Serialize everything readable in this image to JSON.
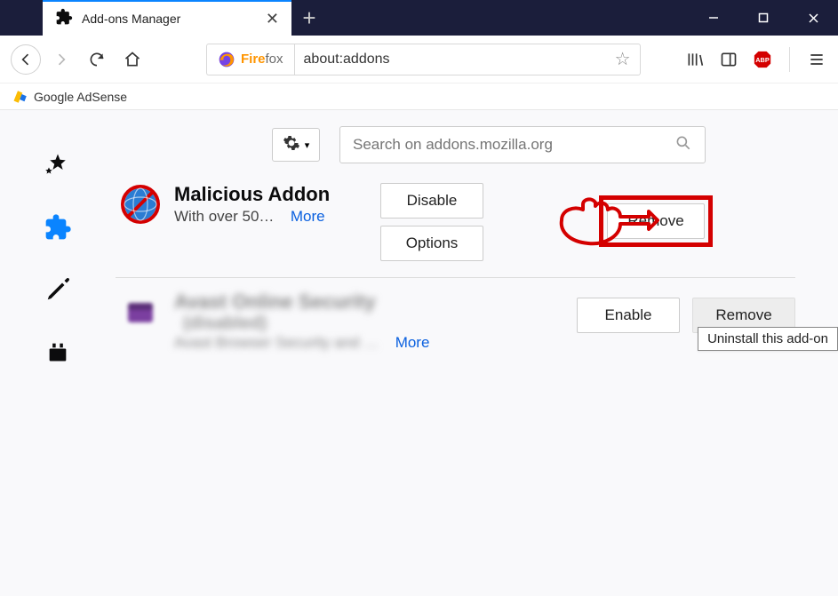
{
  "window": {
    "tab_title": "Add-ons Manager"
  },
  "toolbar": {
    "identity_prefix": "Fire",
    "identity_suffix": "fox",
    "url": "about:addons"
  },
  "bookmarks": {
    "adsense": "Google AdSense"
  },
  "addons_page": {
    "search_placeholder": "Search on addons.mozilla.org",
    "items": [
      {
        "name": "Malicious Addon",
        "description": "With over 50…",
        "more": "More",
        "disable": "Disable",
        "options": "Options",
        "remove": "Remove"
      },
      {
        "name": "Avast Online Security",
        "disabled_tag": "(disabled)",
        "description": "Avast Browser Security and …",
        "more": "More",
        "enable": "Enable",
        "remove": "Remove"
      }
    ]
  },
  "tooltip": "Uninstall this add-on"
}
